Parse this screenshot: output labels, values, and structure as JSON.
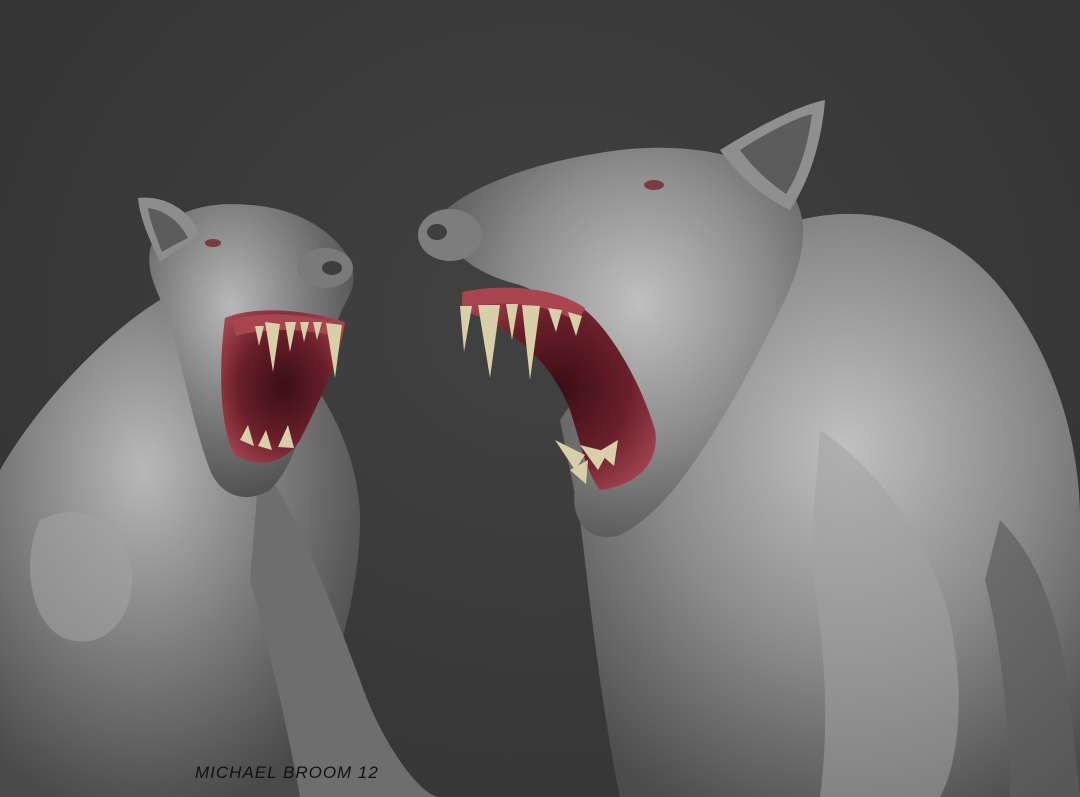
{
  "artwork": {
    "subject": "two-snarling-beast-sculpts",
    "signature": "MICHAEL BROOM 12",
    "colors": {
      "background": "#3b3b3b",
      "clay": "#8a8a8a",
      "clay_highlight": "#c4c4c4",
      "clay_shadow": "#4a4a4a",
      "gums": "#9a3a45",
      "mouth_inner": "#6a1f2a",
      "teeth": "#d8cfa8"
    }
  }
}
